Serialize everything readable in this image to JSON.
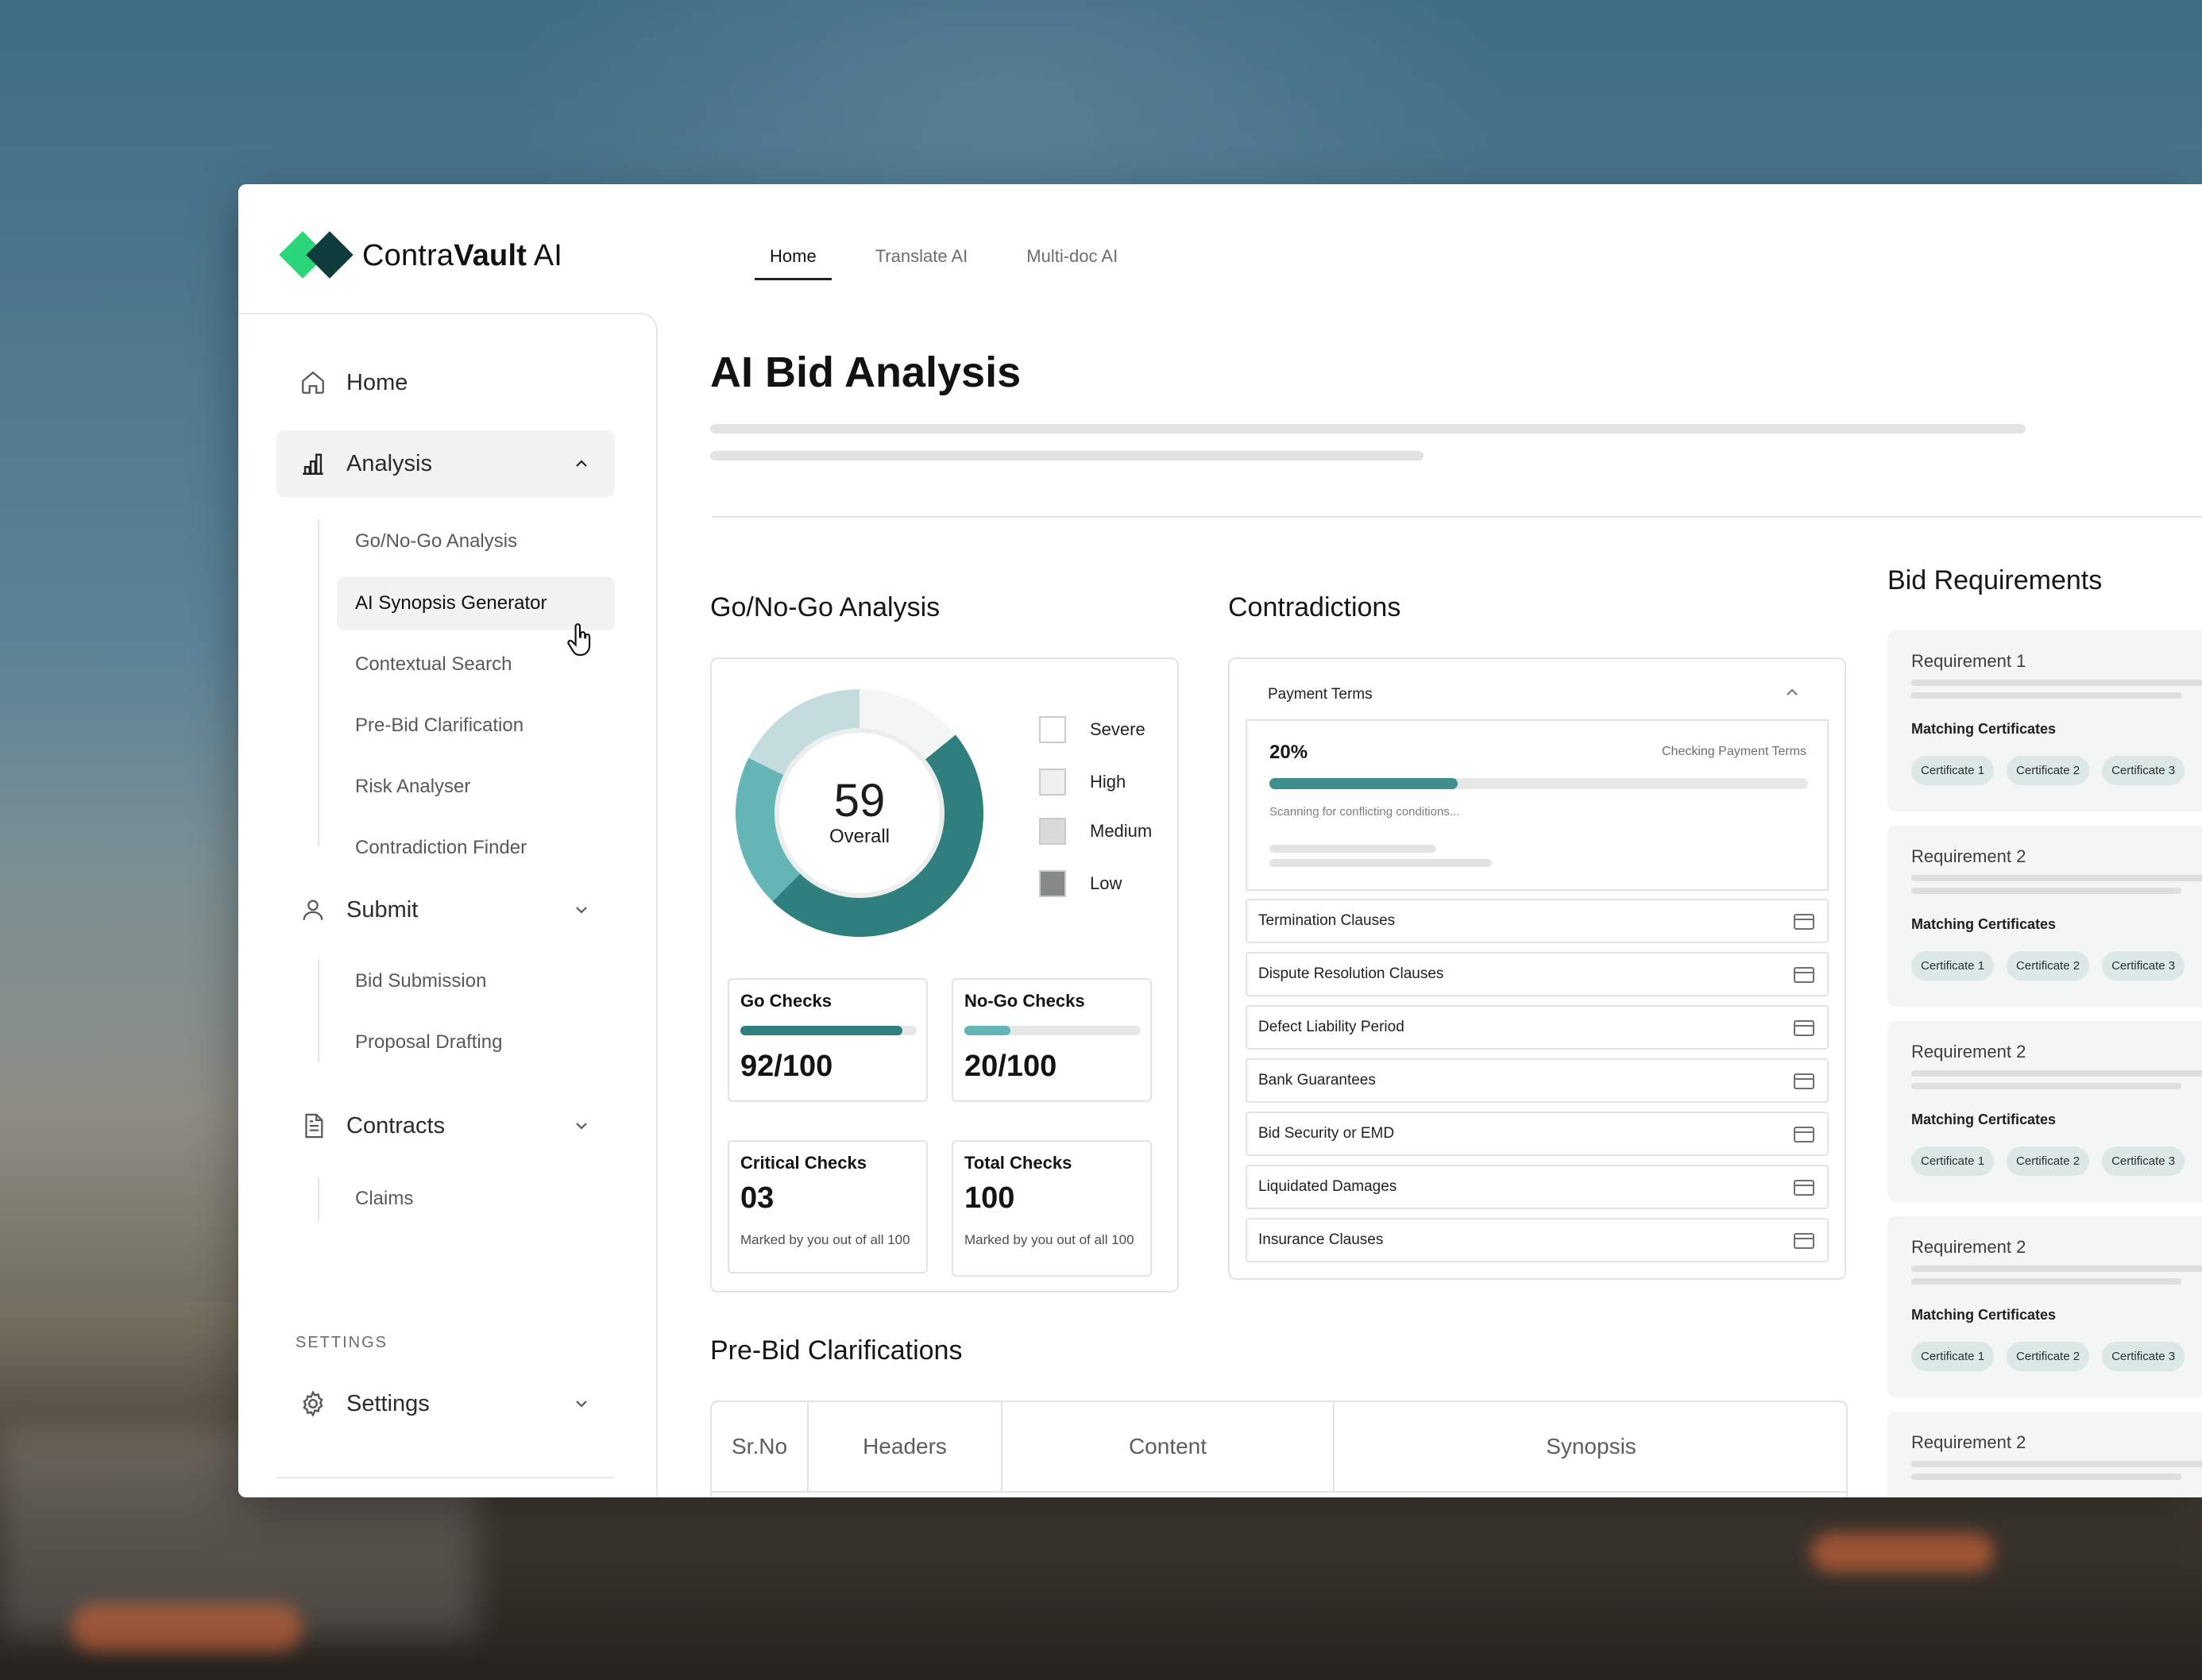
{
  "brand": {
    "name_regular": "Contra",
    "name_bold": "Vault",
    "name_suffix": " AI"
  },
  "topnav": {
    "tabs": [
      {
        "label": "Home"
      },
      {
        "label": "Translate AI"
      },
      {
        "label": "Multi-doc AI"
      }
    ]
  },
  "sidebar": {
    "home": "Home",
    "analysis": {
      "label": "Analysis",
      "items": [
        "Go/No-Go Analysis",
        "AI Synopsis Generator",
        "Contextual Search",
        "Pre-Bid Clarification",
        "Risk Analyser",
        "Contradiction Finder"
      ]
    },
    "submit": {
      "label": "Submit",
      "items": [
        "Bid Submission",
        "Proposal Drafting"
      ]
    },
    "contracts": {
      "label": "Contracts",
      "items": [
        "Claims"
      ]
    },
    "settings_caption": "SETTINGS",
    "settings": "Settings"
  },
  "main": {
    "title": "AI Bid Analysis",
    "gonogo": {
      "title": "Go/No-Go Analysis",
      "score": "59",
      "score_label": "Overall",
      "segments": [
        {
          "name": "Severe",
          "value": 12,
          "color": "#f4f5f5"
        },
        {
          "name": "Low",
          "value": 41,
          "color": "#2f7f7e"
        },
        {
          "name": "High",
          "value": 17,
          "color": "#63b6b5"
        },
        {
          "name": "Medium",
          "value": 15,
          "color": "#c5dcdf"
        }
      ],
      "legend": [
        {
          "label": "Severe",
          "color": "#ffffff"
        },
        {
          "label": "High",
          "color": "#eef0ef"
        },
        {
          "label": "Medium",
          "color": "#d9dbda"
        },
        {
          "label": "Low",
          "color": "#858a86"
        }
      ],
      "go_checks": {
        "label": "Go Checks",
        "value": "92/100",
        "fraction": 0.92
      },
      "nogo_checks": {
        "label": "No-Go Checks",
        "value": "20/100",
        "fraction": 0.26
      },
      "critical_checks": {
        "label": "Critical Checks",
        "value": "03",
        "note": "Marked by you out of all 100"
      },
      "total_checks": {
        "label": "Total Checks",
        "value": "100",
        "note": "Marked by you out of all 100"
      }
    },
    "contradictions": {
      "title": "Contradictions",
      "expanded": {
        "label": "Payment Terms",
        "percent": "20%",
        "status": "Checking Payment Terms",
        "progress": 0.35,
        "scanning": "Scanning for conflicting conditions..."
      },
      "items": [
        "Termination Clauses",
        "Dispute Resolution Clauses",
        "Defect Liability Period",
        "Bank Guarantees",
        "Bid Security or EMD",
        "Liquidated Damages",
        "Insurance Clauses"
      ]
    },
    "requirements": {
      "title": "Bid Requirements",
      "matching_label": "Matching Certificates",
      "items": [
        {
          "title": "Requirement 1",
          "chips": [
            "Certificate 1",
            "Certificate 2",
            "Certificate 3"
          ]
        },
        {
          "title": "Requirement 2",
          "chips": [
            "Certificate 1",
            "Certificate 2",
            "Certificate 3"
          ]
        },
        {
          "title": "Requirement 2",
          "chips": [
            "Certificate 1",
            "Certificate 2",
            "Certificate 3"
          ]
        },
        {
          "title": "Requirement 2",
          "chips": [
            "Certificate 1",
            "Certificate 2",
            "Certificate 3"
          ]
        },
        {
          "title": "Requirement 2",
          "chips": []
        }
      ]
    },
    "prebid": {
      "title": "Pre-Bid Clarifications",
      "headers": [
        "Sr.No",
        "Headers",
        "Content",
        "Synopsis"
      ]
    }
  }
}
